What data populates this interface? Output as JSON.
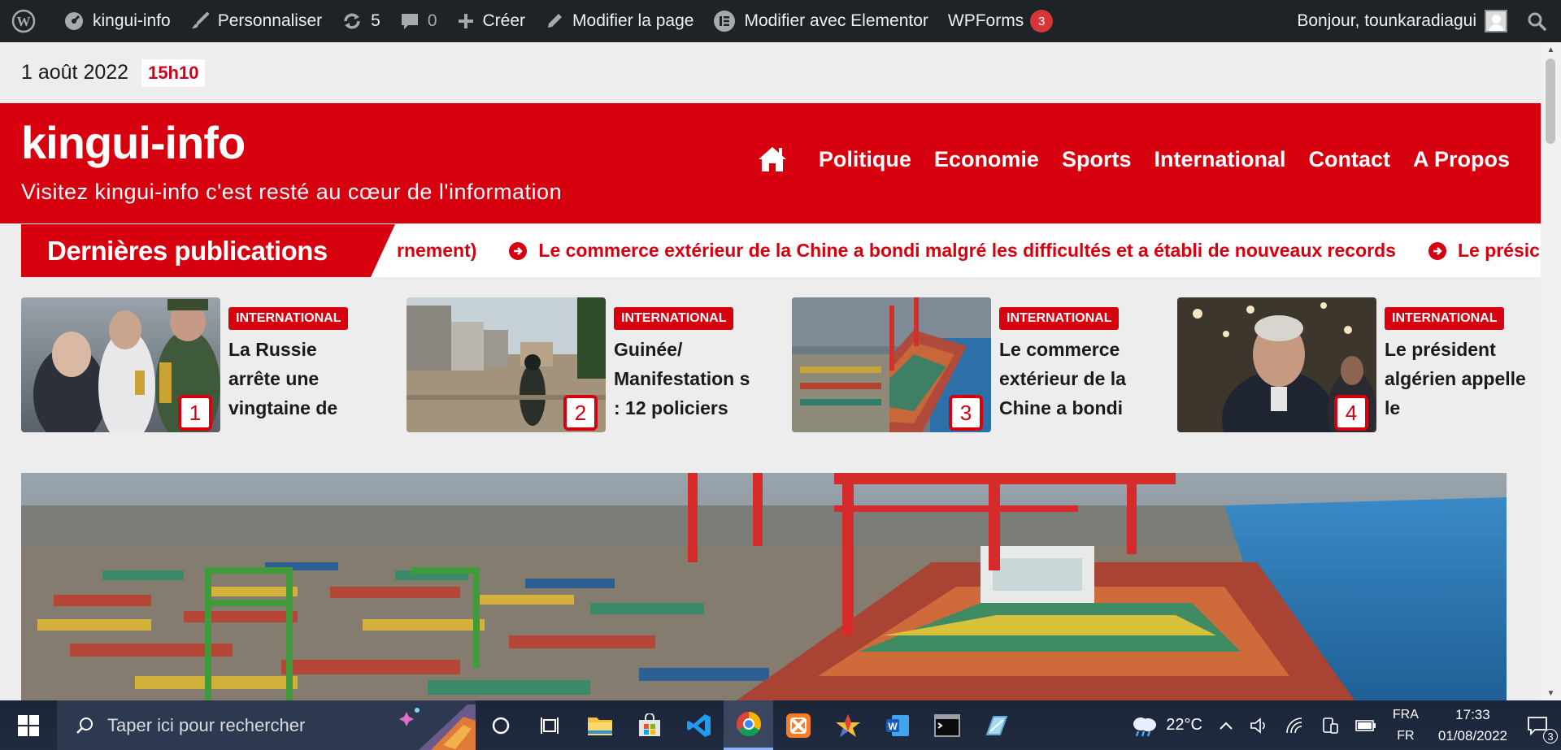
{
  "adminbar": {
    "site_name": "kingui-info",
    "customize": "Personnaliser",
    "updates_count": "5",
    "comments_count": "0",
    "new_label": "Créer",
    "edit_page": "Modifier la page",
    "elementor": "Modifier avec Elementor",
    "wpforms": "WPForms",
    "wpforms_badge": "3",
    "greeting": "Bonjour, tounkaradiagui"
  },
  "topbar": {
    "date": "1 août 2022",
    "time": "15h10"
  },
  "header": {
    "logo": "kingui-info",
    "tagline": "Visitez kingui-info c'est resté au cœur de l'information",
    "nav": [
      "Politique",
      "Economie",
      "Sports",
      "International",
      "Contact",
      "A Propos"
    ]
  },
  "ticker": {
    "label": "Dernières publications",
    "items": [
      "rnement)",
      "Le commerce extérieur de la Chine a bondi malgré les difficultés et a établi de nouveaux records",
      "Le présic"
    ]
  },
  "posts": [
    {
      "num": "1",
      "category": "INTERNATIONAL",
      "title": "La Russie arrête une vingtaine de"
    },
    {
      "num": "2",
      "category": "INTERNATIONAL",
      "title": "Guinée/ Manifestation s : 12 policiers"
    },
    {
      "num": "3",
      "category": "INTERNATIONAL",
      "title": "Le commerce extérieur de la Chine a bondi"
    },
    {
      "num": "4",
      "category": "INTERNATIONAL",
      "title": "Le président algérien appelle le"
    }
  ],
  "taskbar": {
    "search_placeholder": "Taper ici pour rechercher",
    "weather": "22°C",
    "lang_top": "FRA",
    "lang_bottom": "FR",
    "time": "17:33",
    "date": "01/08/2022",
    "notification_count": "3"
  },
  "colors": {
    "brand_red": "#d7000f",
    "adminbar_bg": "#1d2327",
    "taskbar_bg": "#202b40"
  }
}
